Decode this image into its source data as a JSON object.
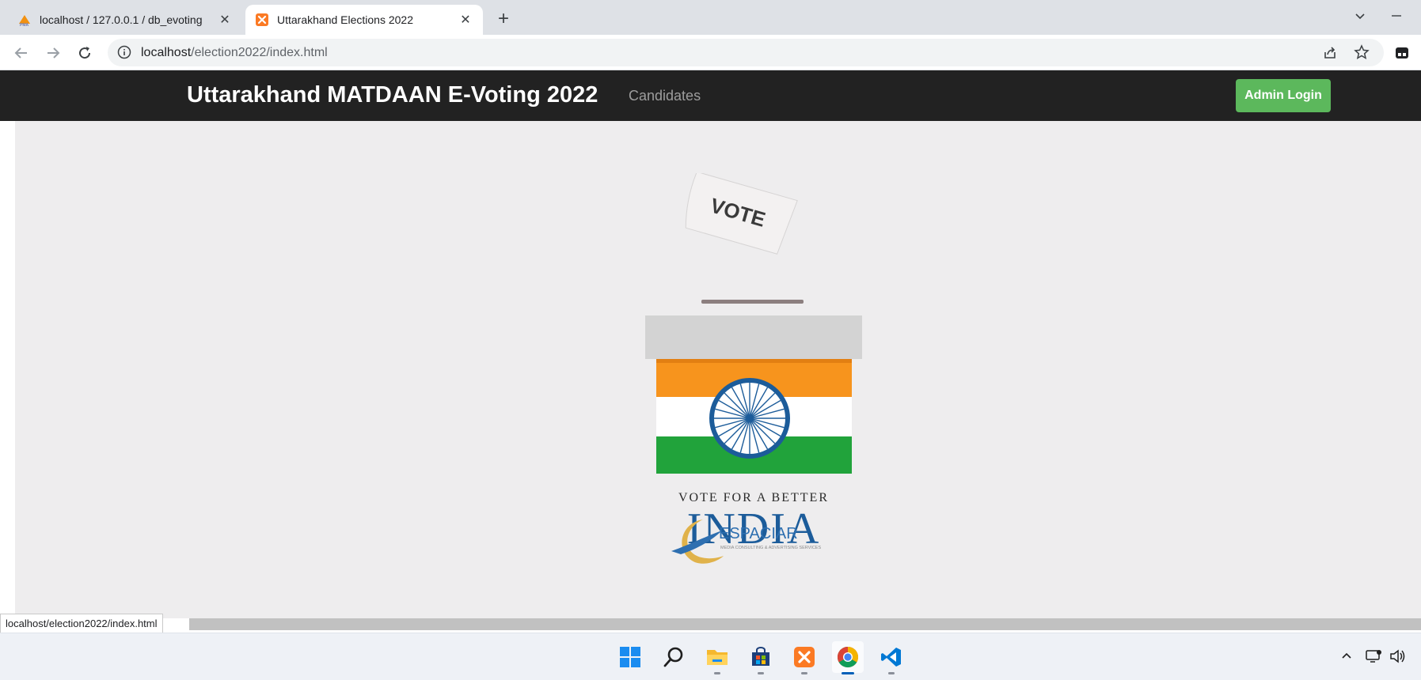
{
  "browser": {
    "tabs": [
      {
        "title": "localhost / 127.0.0.1 / db_evoting",
        "favicon": "phpmyadmin-icon"
      },
      {
        "title": "Uttarakhand Elections 2022",
        "favicon": "xampp-icon"
      }
    ],
    "url_host": "localhost",
    "url_path": "/election2022/index.html"
  },
  "site": {
    "brand": "Uttarakhand MATDAAN E-Voting 2022",
    "nav_candidates": "Candidates",
    "admin_login": "Admin Login"
  },
  "hero": {
    "ballot_text": "VOTE",
    "tagline": "VOTE FOR A BETTER",
    "country": "INDIA",
    "logo_name": "ESPACIAR",
    "logo_sub": "MEDIA CONSULTING & ADVERTISING SERVICES"
  },
  "status_url": "localhost/election2022/index.html",
  "colors": {
    "navbar": "#222222",
    "admin_button": "#5cb85c",
    "saffron": "#f7941d",
    "green": "#21a33b",
    "chakra": "#1c5c9a"
  },
  "taskbar": {
    "apps": [
      "start-icon",
      "search-icon",
      "file-explorer-icon",
      "store-icon",
      "xampp-icon",
      "chrome-icon",
      "vscode-icon"
    ]
  }
}
